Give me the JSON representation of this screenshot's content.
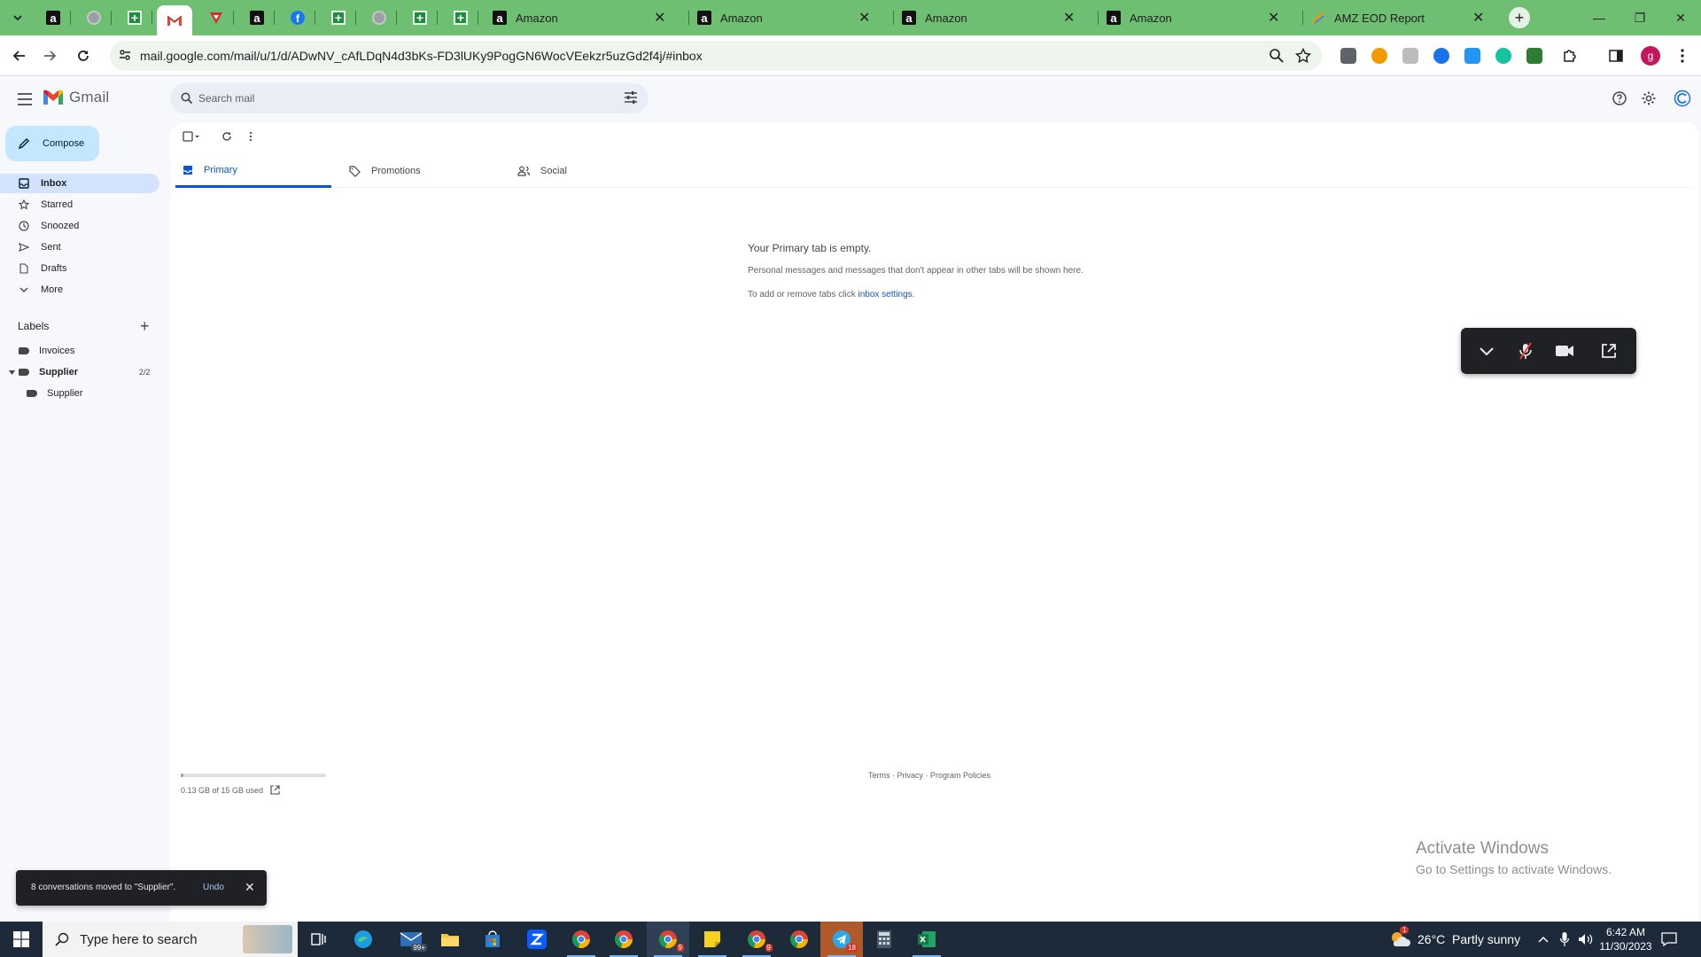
{
  "browser": {
    "url": "mail.google.com/mail/u/1/d/ADwNV_cAfLDqN4d3bKs-FD3lUKy9PogGN6WocVEekzr5uzGd2f4j/#inbox",
    "tabs": [
      {
        "title": "Amazon"
      },
      {
        "title": "Amazon"
      },
      {
        "title": "Amazon"
      },
      {
        "title": "Amazon"
      },
      {
        "title": "AMZ EOD Report"
      }
    ],
    "profile_initial": "g"
  },
  "gmail": {
    "logo_text": "Gmail",
    "search_placeholder": "Search mail",
    "compose_label": "Compose",
    "nav": [
      {
        "label": "Inbox",
        "icon": "inbox-icon"
      },
      {
        "label": "Starred",
        "icon": "star-icon"
      },
      {
        "label": "Snoozed",
        "icon": "clock-icon"
      },
      {
        "label": "Sent",
        "icon": "send-icon"
      },
      {
        "label": "Drafts",
        "icon": "draft-icon"
      },
      {
        "label": "More",
        "icon": "chevron-down-icon"
      }
    ],
    "labels_title": "Labels",
    "labels": [
      {
        "label": "Invoices"
      },
      {
        "label": "Supplier",
        "count": "2/2"
      },
      {
        "label": "Supplier"
      }
    ],
    "tabs": [
      {
        "label": "Primary"
      },
      {
        "label": "Promotions"
      },
      {
        "label": "Social"
      }
    ],
    "empty": {
      "title": "Your Primary tab is empty.",
      "description": "Personal messages and messages that don't appear in other tabs will be shown here.",
      "hint_prefix": "To add or remove tabs click ",
      "hint_link": "inbox settings",
      "hint_suffix": "."
    },
    "storage": {
      "text": "0.13 GB of 15 GB used",
      "used_fraction": 0.009
    },
    "footer": "Terms · Privacy · Program Policies",
    "snackbar": {
      "message": "8 conversations moved to \"Supplier\".",
      "action": "Undo"
    }
  },
  "watermark": {
    "line1": "Activate Windows",
    "line2": "Go to Settings to activate Windows."
  },
  "taskbar": {
    "search_placeholder": "Type here to search",
    "weather": "26°C  Partly sunny",
    "weather_badge": "1",
    "time": "6:42 AM",
    "date": "11/30/2023",
    "badges": {
      "mail": "99+",
      "chrome1": "9",
      "chrome2": "9",
      "telegram": "18"
    }
  },
  "colors": {
    "tab_strip": "#6fbf73",
    "compose": "#c2e7ff",
    "active_nav": "#d3e3fd",
    "accent": "#0b57d0",
    "taskbar": "#1c2a3a"
  }
}
